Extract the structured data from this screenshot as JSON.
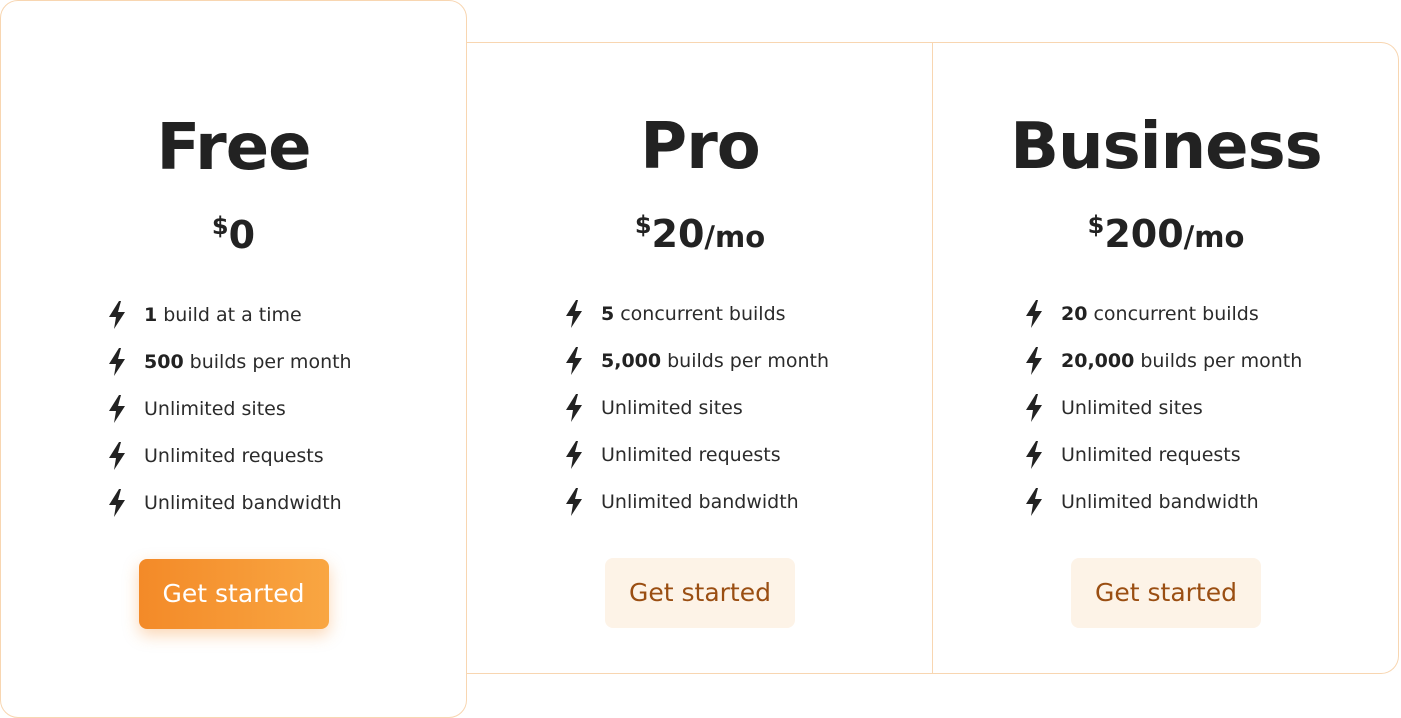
{
  "plans": [
    {
      "name": "Free",
      "currency": "$",
      "amount": "0",
      "period": "",
      "features": [
        {
          "bold": "1",
          "text": "build at a time"
        },
        {
          "bold": "500",
          "text": "builds per month"
        },
        {
          "bold": "",
          "text": "Unlimited sites"
        },
        {
          "bold": "",
          "text": "Unlimited requests"
        },
        {
          "bold": "",
          "text": "Unlimited bandwidth"
        }
      ],
      "cta": "Get started"
    },
    {
      "name": "Pro",
      "currency": "$",
      "amount": "20",
      "period": "/mo",
      "features": [
        {
          "bold": "5",
          "text": "concurrent builds"
        },
        {
          "bold": "5,000",
          "text": "builds per month"
        },
        {
          "bold": "",
          "text": "Unlimited sites"
        },
        {
          "bold": "",
          "text": "Unlimited requests"
        },
        {
          "bold": "",
          "text": "Unlimited bandwidth"
        }
      ],
      "cta": "Get started"
    },
    {
      "name": "Business",
      "currency": "$",
      "amount": "200",
      "period": "/mo",
      "features": [
        {
          "bold": "20",
          "text": "concurrent builds"
        },
        {
          "bold": "20,000",
          "text": "builds per month"
        },
        {
          "bold": "",
          "text": "Unlimited sites"
        },
        {
          "bold": "",
          "text": "Unlimited requests"
        },
        {
          "bold": "",
          "text": "Unlimited bandwidth"
        }
      ],
      "cta": "Get started"
    }
  ],
  "icons": {
    "feature": "lightning-bolt-icon"
  },
  "colors": {
    "accent_start": "#f38a28",
    "accent_end": "#f9a642",
    "border": "#f8d6b1",
    "secondary_button_bg": "#fdf3e7",
    "secondary_button_text": "#9a4e12",
    "text": "#222222"
  }
}
